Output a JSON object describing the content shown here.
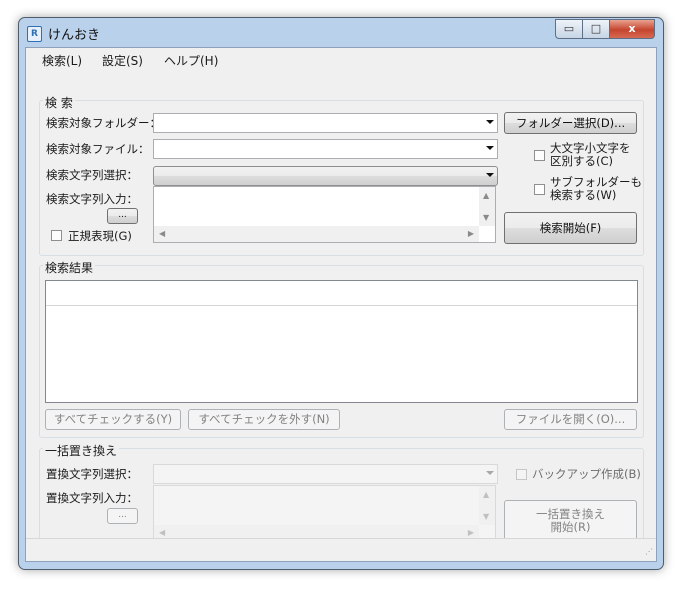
{
  "window": {
    "title": "けんおき",
    "app_icon": "R",
    "controls": {
      "minimize": "▭",
      "maximize": "□",
      "close": "x"
    }
  },
  "menu": [
    "検索(L)",
    "設定(S)",
    "ヘルプ(H)"
  ],
  "search": {
    "legend": "検 索",
    "folder_label": "検索対象フォルダー：",
    "file_label": "検索対象ファイル：",
    "string_select_label": "検索文字列選択：",
    "string_input_label": "検索文字列入力：",
    "folder_value": "",
    "file_value": "",
    "ellipsis": "...",
    "regex_label": "正規表現(G)",
    "regex_checked": false,
    "folder_select_button": "フォルダー選択(D)...",
    "case_sensitive_label": "大文字小文字を\n区別する(C)",
    "case_sensitive_checked": false,
    "subfolders_label": "サブフォルダーも\n検索する(W)",
    "subfolders_checked": false,
    "start_button": "検索開始(F)"
  },
  "results": {
    "legend": "検索結果",
    "check_all": "すべてチェックする(Y)",
    "uncheck_all": "すべてチェックを外す(N)",
    "open_file": "ファイルを開く(O)..."
  },
  "replace": {
    "legend": "一括置き換え",
    "select_label": "置換文字列選択：",
    "input_label": "置換文字列入力：",
    "ellipsis": "...",
    "backup_label": "バックアップ作成(B)",
    "backup_checked": false,
    "start_button": "一括置き換え\n開始(R)"
  },
  "icons": {
    "dropdown": "chevron-down-icon",
    "scroll_up": "▲",
    "scroll_down": "▼",
    "scroll_left": "◀",
    "scroll_right": "▶",
    "resize_grip": "resize-grip-icon"
  }
}
